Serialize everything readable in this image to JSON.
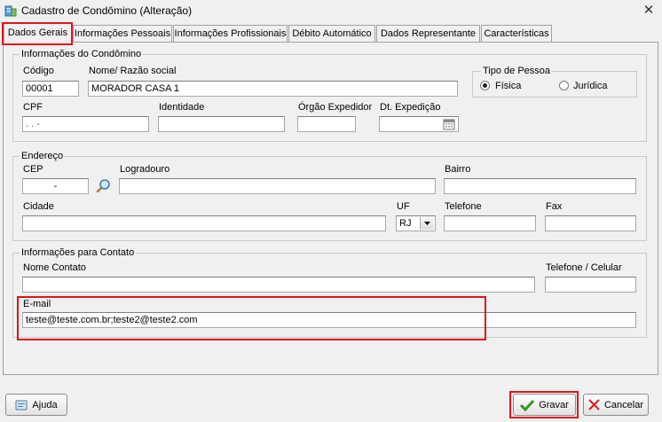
{
  "window": {
    "title": "Cadastro de Condômino (Alteração)",
    "close_glyph": "✕"
  },
  "tabs": [
    {
      "label": "Dados Gerais"
    },
    {
      "label": "Informações Pessoais"
    },
    {
      "label": "Informações Profissionais"
    },
    {
      "label": "Débito Automático"
    },
    {
      "label": "Dados Representante"
    },
    {
      "label": "Características"
    }
  ],
  "info_condominio": {
    "title": "Informações do Condômino",
    "codigo_label": "Código",
    "codigo_value": "00001",
    "nome_label": "Nome/ Razão social",
    "nome_value": "MORADOR CASA 1",
    "cpf_label": "CPF",
    "cpf_value": ".   .   -",
    "identidade_label": "Identidade",
    "identidade_value": "",
    "orgao_label": "Órgão Expedidor",
    "orgao_value": "",
    "dt_label": "Dt. Expedição",
    "dt_value": "",
    "tipo_pessoa_title": "Tipo de Pessoa",
    "fisica_label": "Física",
    "juridica_label": "Jurídica"
  },
  "endereco": {
    "title": "Endereço",
    "cep_label": "CEP",
    "cep_value": "-",
    "logradouro_label": "Logradouro",
    "logradouro_value": "",
    "bairro_label": "Bairro",
    "bairro_value": "",
    "cidade_label": "Cidade",
    "cidade_value": "",
    "uf_label": "UF",
    "uf_value": "RJ",
    "telefone_label": "Telefone",
    "telefone_value": "",
    "fax_label": "Fax",
    "fax_value": ""
  },
  "contato": {
    "title": "Informações para Contato",
    "nome_label": "Nome Contato",
    "nome_value": "",
    "telefone_label": "Telefone / Celular",
    "telefone_value": "",
    "email_label": "E-mail",
    "email_value": "teste@teste.com.br;teste2@teste2.com"
  },
  "buttons": {
    "ajuda": "Ajuda",
    "gravar": "Gravar",
    "cancelar": "Cancelar"
  },
  "colors": {
    "highlight": "#e0141c",
    "save_check": "#2e9a1f",
    "cancel_x": "#d42020"
  }
}
